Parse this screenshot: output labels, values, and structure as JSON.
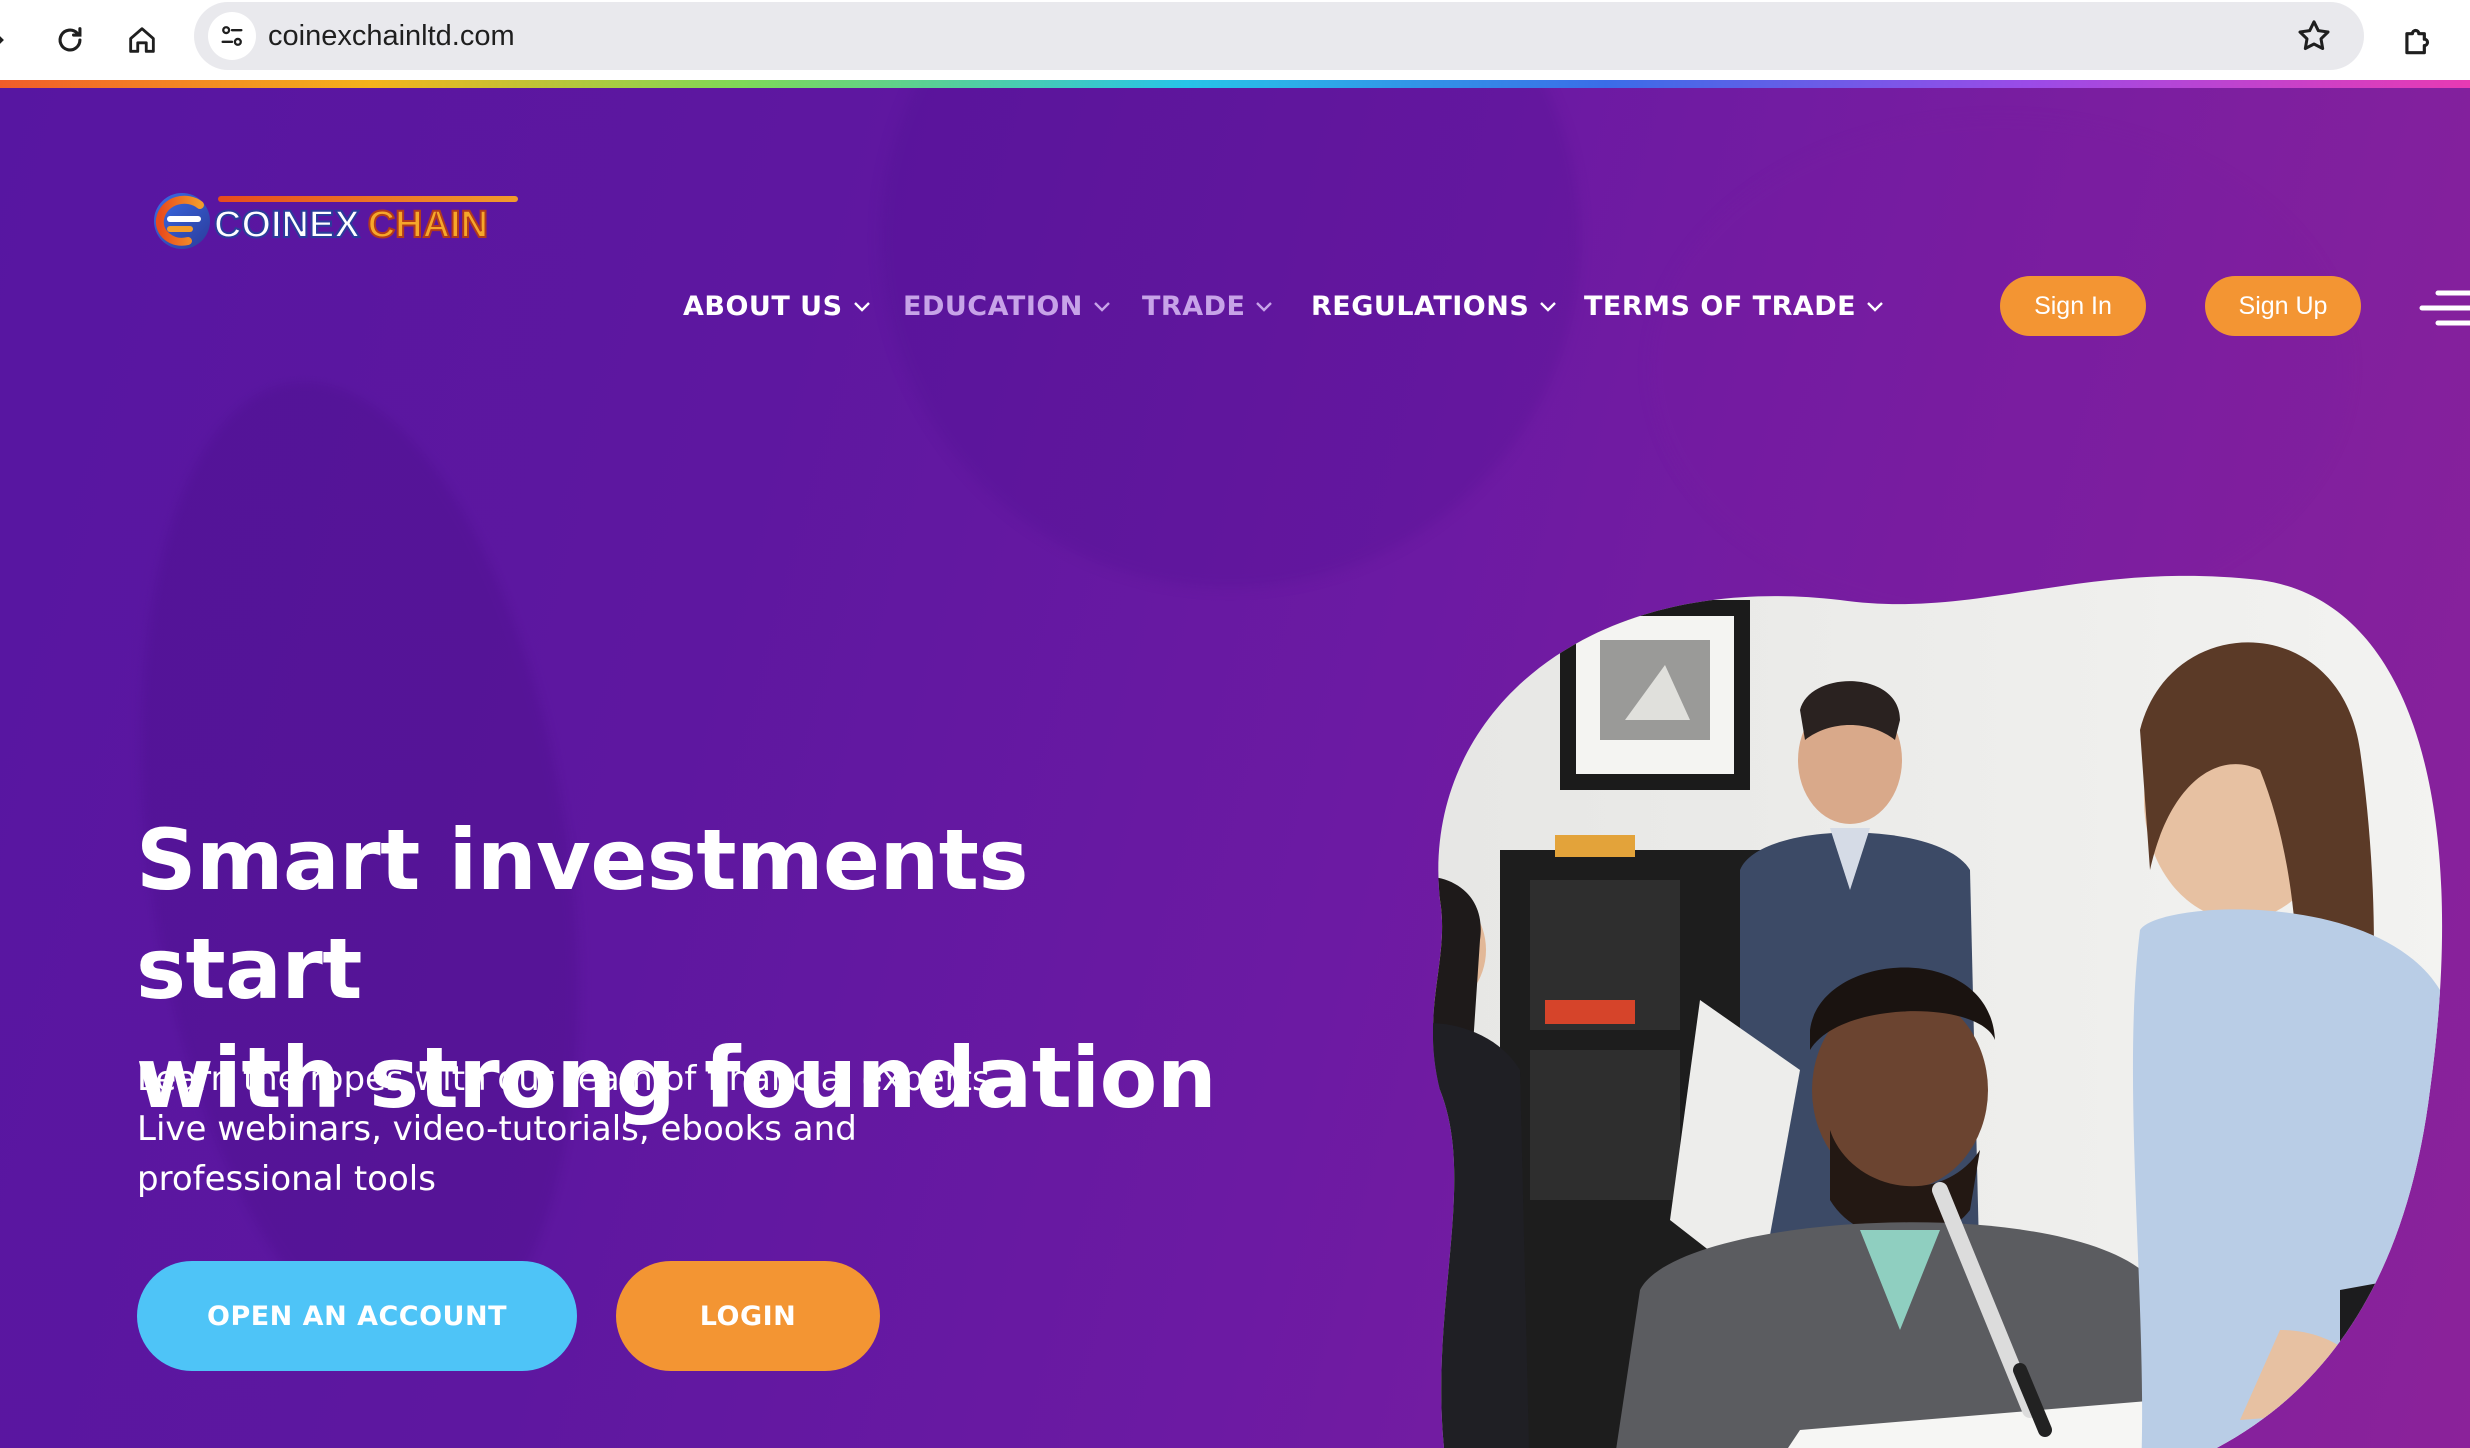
{
  "browser": {
    "url": "coinexchainltd.com",
    "icons": {
      "reload": "reload-icon",
      "home": "home-icon",
      "site_info": "tune-icon",
      "bookmark": "star-icon",
      "extensions": "puzzle-icon"
    }
  },
  "site": {
    "logo": {
      "word1": "COINEX",
      "word2": "CHAIN"
    },
    "nav": [
      {
        "label": "ABOUT US",
        "active": true
      },
      {
        "label": "EDUCATION",
        "active": false
      },
      {
        "label": "TRADE",
        "active": false
      },
      {
        "label": "REGULATIONS",
        "active": true
      },
      {
        "label": "TERMS OF TRADE",
        "active": true
      }
    ],
    "sign_in": "Sign In",
    "sign_up": "Sign Up"
  },
  "hero": {
    "headline_line1": "Smart investments start",
    "headline_line2": "with strong foundation",
    "sub_line1": "Learn the ropes with our team of financial experts",
    "sub_line2": "Live webinars, video-tutorials, ebooks and",
    "sub_line3": "professional tools",
    "cta_primary": "OPEN AN ACCOUNT",
    "cta_secondary": "LOGIN"
  },
  "colors": {
    "accent_orange": "#f39533",
    "accent_blue": "#4ec4f7",
    "bg_purple_start": "#5716a1",
    "bg_purple_end": "#8b229a",
    "nav_dim": "#c7a3e8"
  }
}
